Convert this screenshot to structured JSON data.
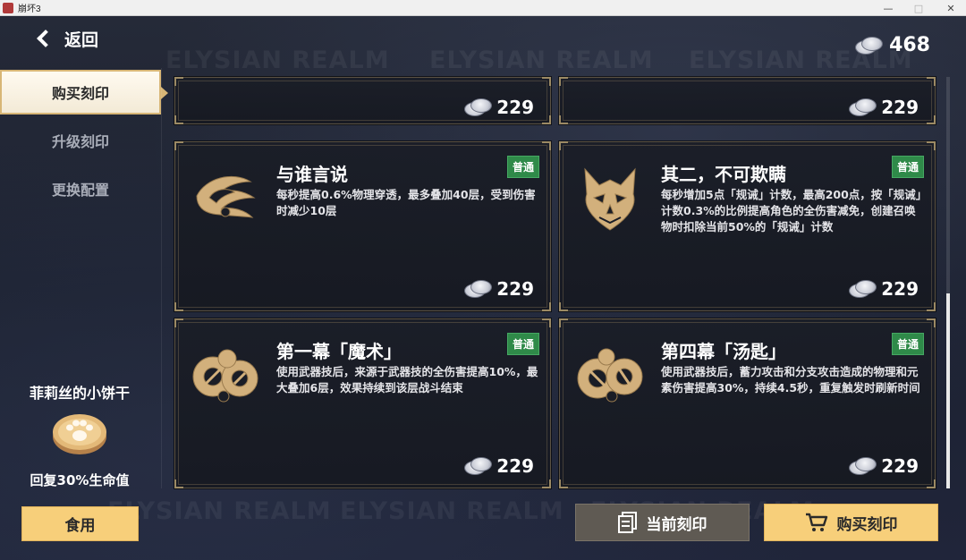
{
  "window": {
    "title": "崩坏3"
  },
  "header": {
    "back_label": "返回",
    "currency_amount": "468"
  },
  "watermark": "ELYSIAN REALM",
  "sidebar": {
    "tabs": [
      {
        "label": "购买刻印",
        "active": true
      },
      {
        "label": "升级刻印",
        "active": false
      },
      {
        "label": "更换配置",
        "active": false
      }
    ],
    "item": {
      "name": "菲莉丝的小饼干",
      "effect": "回复30%生命值"
    },
    "use_label": "食用"
  },
  "cards": [
    {
      "price": "229"
    },
    {
      "price": "229"
    },
    {
      "name": "与谁言说",
      "rarity": "普通",
      "desc": "每秒提高0.6%物理穿透，最多叠加40层，受到伤害时减少10层",
      "price": "229",
      "icon": "wings-emblem-icon"
    },
    {
      "name": "其二，不可欺瞒",
      "rarity": "普通",
      "desc": "每秒增加5点「规诫」计数，最高200点，按「规诫」计数0.3%的比例提高角色的全伤害减免，创建召唤物时扣除当前50%的「规诫」计数",
      "price": "229",
      "icon": "masked-cat-emblem-icon"
    },
    {
      "name": "第一幕「魔术」",
      "rarity": "普通",
      "desc": "使用武器技后，来源于武器技的全伤害提高10%，最大叠加6层，效果持续到该层战斗结束",
      "price": "229",
      "icon": "clockwork-emblem-icon"
    },
    {
      "name": "第四幕「汤匙」",
      "rarity": "普通",
      "desc": "使用武器技后，蓄力攻击和分支攻击造成的物理和元素伤害提高30%，持续4.5秒，重复触发时刷新时间",
      "price": "229",
      "icon": "clockwork-emblem-icon"
    }
  ],
  "footer": {
    "current_label": "当前刻印",
    "buy_label": "购买刻印"
  },
  "colors": {
    "accent": "#f7cf7a",
    "badge": "#2f8a49",
    "card_border": "#5a5142"
  }
}
